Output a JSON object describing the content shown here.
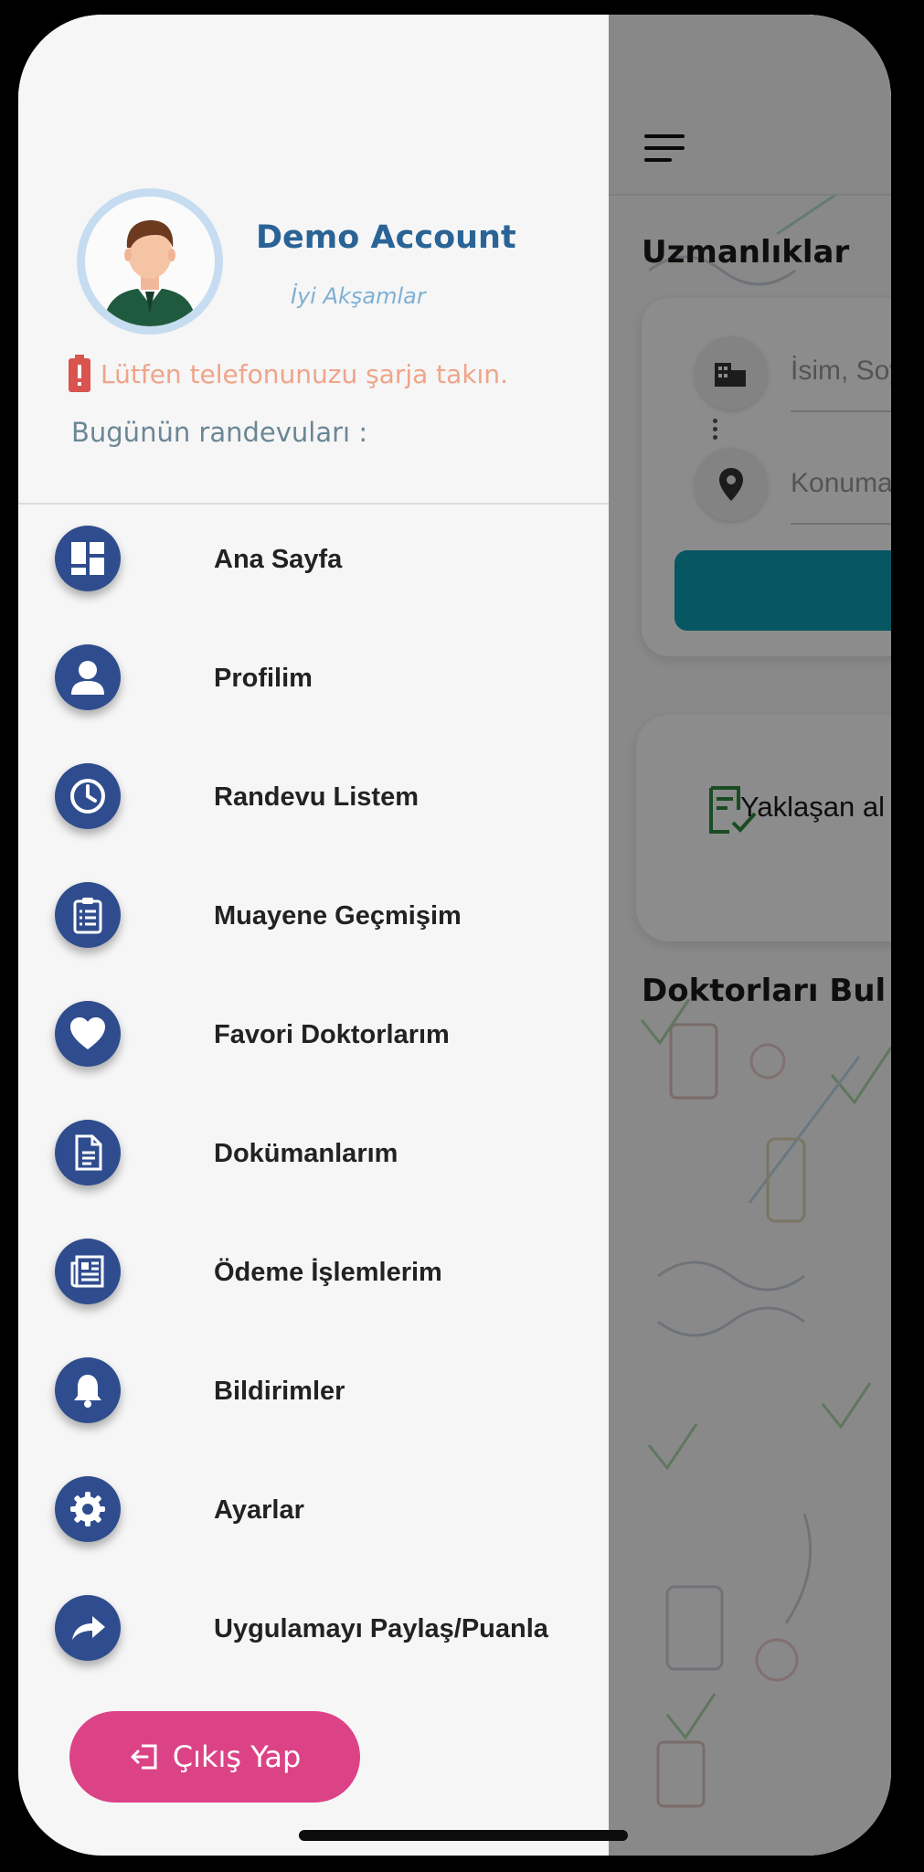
{
  "background_app": {
    "specialties_title": "Uzmanlıklar",
    "search_name_placeholder": "İsim, Soy",
    "search_location_placeholder": "Konuma",
    "upcoming_label": "Yaklaşan al",
    "find_doctors_title": "Doktorları Bul"
  },
  "drawer": {
    "user_name": "Demo Account",
    "greeting": "İyi Akşamlar",
    "battery_warning": "Lütfen telefonunuzu şarja takın.",
    "today_appointments_label": "Bugünün randevuları :",
    "menu": [
      {
        "label": "Ana Sayfa",
        "icon": "dashboard-icon"
      },
      {
        "label": "Profilim",
        "icon": "user-icon"
      },
      {
        "label": "Randevu Listem",
        "icon": "clock-icon"
      },
      {
        "label": "Muayene Geçmişim",
        "icon": "clipboard-icon"
      },
      {
        "label": "Favori Doktorlarım",
        "icon": "heart-icon"
      },
      {
        "label": "Dokümanlarım",
        "icon": "document-icon"
      },
      {
        "label": "Ödeme İşlemlerim",
        "icon": "newspaper-icon"
      },
      {
        "label": "Bildirimler",
        "icon": "bell-icon"
      },
      {
        "label": "Ayarlar",
        "icon": "gear-icon"
      },
      {
        "label": "Uygulamayı Paylaş/Puanla",
        "icon": "share-icon"
      }
    ],
    "logout_label": "Çıkış Yap"
  },
  "colors": {
    "menu_icon_bg": "#2f4d8e",
    "logout_bg": "#dc4386",
    "user_name": "#2a6496",
    "warning": "#f0a48a",
    "teal_button": "#0c9fb3"
  }
}
